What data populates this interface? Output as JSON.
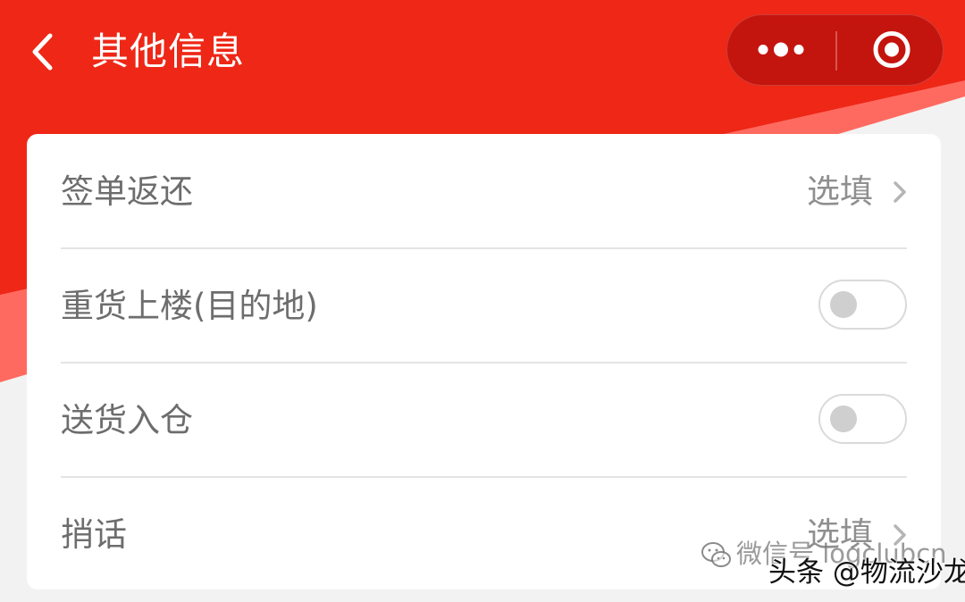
{
  "theme": {
    "header_red": "#ee2716",
    "light_red": "#ff6a60",
    "background": "#f2f2f2"
  },
  "header": {
    "title": "其他信息",
    "back_icon": "chevron-left-icon",
    "menu_icon": "more-dots-icon",
    "close_icon": "target-circle-icon"
  },
  "form": {
    "rows": [
      {
        "label": "签单返还",
        "value": "选填",
        "control": "chevron-right-icon"
      },
      {
        "label": "重货上楼(目的地)",
        "control": "toggle",
        "on": false
      },
      {
        "label": "送货入仓",
        "control": "toggle",
        "on": false
      },
      {
        "label": "捎话",
        "value": "选填",
        "control": "chevron-right-icon"
      }
    ]
  },
  "watermark": {
    "line1": "微信号 logclubcn",
    "line2": "头条 @物流沙龙",
    "icon": "wechat-icon"
  }
}
